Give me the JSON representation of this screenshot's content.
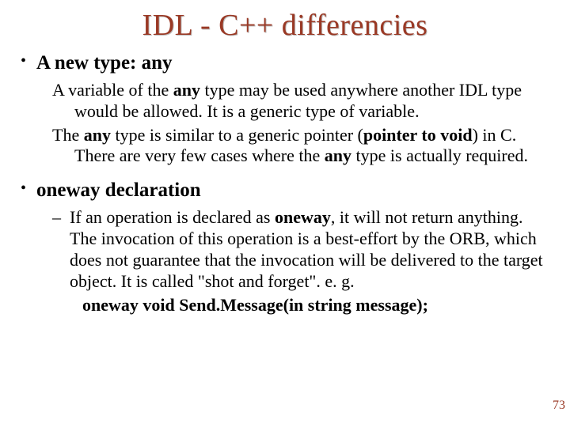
{
  "title": "IDL - C++ differencies",
  "sections": [
    {
      "heading": "A new type: any",
      "paragraphs": [
        {
          "pre": "A variable of the ",
          "bold1": "any",
          "mid": " type may be used anywhere another IDL type would be allowed. It is a generic type of variable."
        },
        {
          "pre": "The ",
          "bold1": "any",
          "mid": " type is similar to a generic pointer (",
          "bold2": "pointer to void",
          "mid2": ") in C. There are very few cases where the ",
          "bold3": "any",
          "mid3": " type is actually required."
        }
      ]
    },
    {
      "heading": "oneway declaration",
      "sub": {
        "pre": "If an operation is declared as ",
        "bold1": "oneway",
        "post": ", it will not return anything. The invocation of this operation is a best-effort by the ORB, which does not guarantee that the invocation will be delivered to the target object. It is called \"shot and forget\". e. g."
      },
      "code": "oneway void Send.Message(in string message);"
    }
  ],
  "page_number": "73"
}
